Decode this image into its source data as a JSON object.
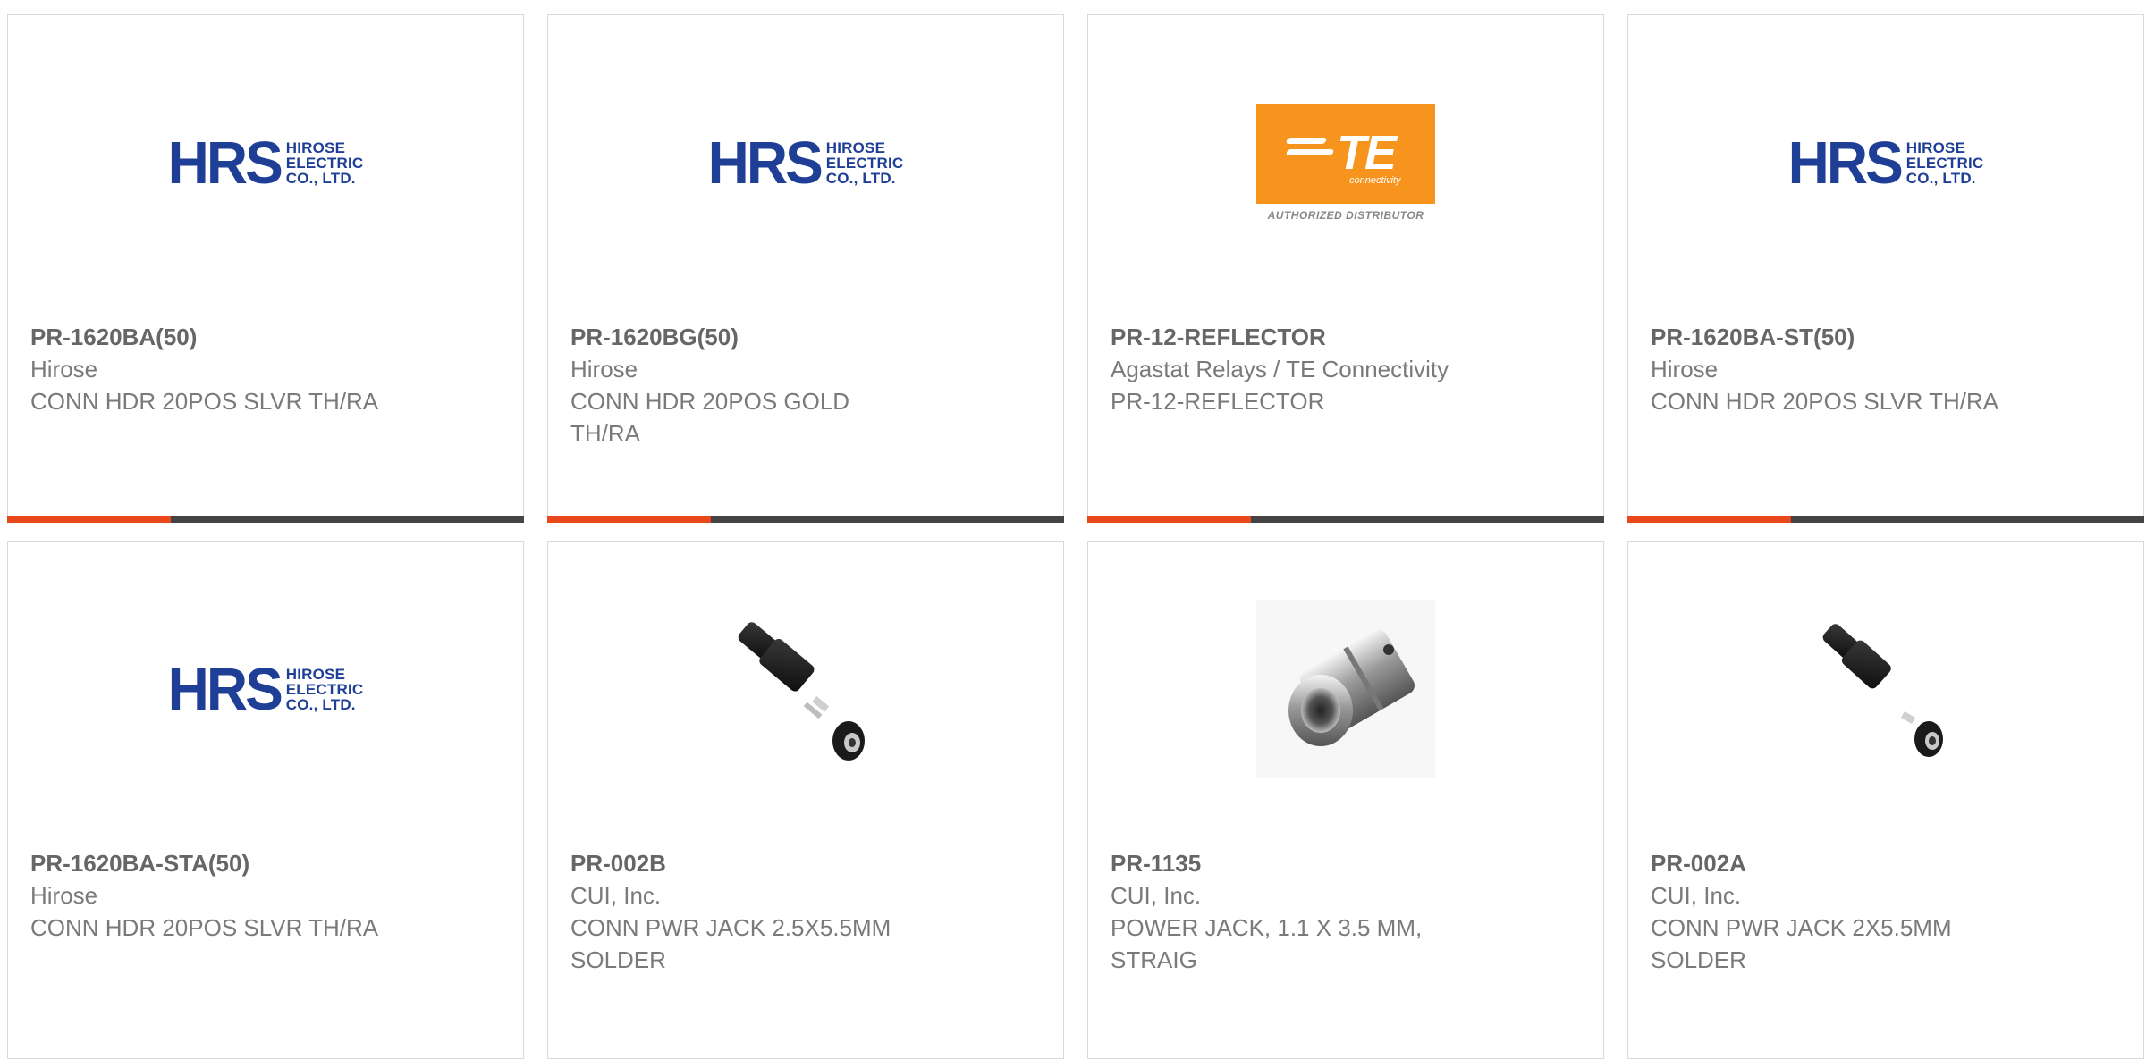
{
  "accent_color": "#e8481c",
  "bar_color": "#444444",
  "products": [
    {
      "part_number": "PR-1620BA(50)",
      "manufacturer": "Hirose",
      "description": "CONN HDR 20POS SLVR TH/RA",
      "image": "hirose-logo",
      "logo_mark": "HRS",
      "logo_text_1": "HIROSE",
      "logo_text_2": "ELECTRIC",
      "logo_text_3": "CO., LTD."
    },
    {
      "part_number": "PR-1620BG(50)",
      "manufacturer": "Hirose",
      "description": "CONN HDR 20POS GOLD\nTH/RA",
      "image": "hirose-logo",
      "logo_mark": "HRS",
      "logo_text_1": "HIROSE",
      "logo_text_2": "ELECTRIC",
      "logo_text_3": "CO., LTD."
    },
    {
      "part_number": "PR-12-REFLECTOR",
      "manufacturer": "Agastat Relays / TE Connectivity",
      "description": "PR-12-REFLECTOR",
      "image": "te-connectivity-logo",
      "logo_mark": "TE",
      "logo_sub": "connectivity",
      "logo_caption": "AUTHORIZED DISTRIBUTOR"
    },
    {
      "part_number": "PR-1620BA-ST(50)",
      "manufacturer": "Hirose",
      "description": "CONN HDR 20POS SLVR TH/RA",
      "image": "hirose-logo",
      "logo_mark": "HRS",
      "logo_text_1": "HIROSE",
      "logo_text_2": "ELECTRIC",
      "logo_text_3": "CO., LTD."
    },
    {
      "part_number": "PR-1620BA-STA(50)",
      "manufacturer": "Hirose",
      "description": "CONN HDR 20POS SLVR TH/RA",
      "image": "hirose-logo",
      "logo_mark": "HRS",
      "logo_text_1": "HIROSE",
      "logo_text_2": "ELECTRIC",
      "logo_text_3": "CO., LTD."
    },
    {
      "part_number": "PR-002B",
      "manufacturer": "CUI, Inc.",
      "description": "CONN PWR JACK 2.5X5.5MM\nSOLDER",
      "image": "power-jack-photo"
    },
    {
      "part_number": "PR-1135",
      "manufacturer": "CUI, Inc.",
      "description": "POWER JACK, 1.1 X 3.5 MM,\nSTRAIG",
      "image": "barrel-connector-photo"
    },
    {
      "part_number": "PR-002A",
      "manufacturer": "CUI, Inc.",
      "description": "CONN PWR JACK 2X5.5MM\nSOLDER",
      "image": "power-jack-photo"
    }
  ]
}
